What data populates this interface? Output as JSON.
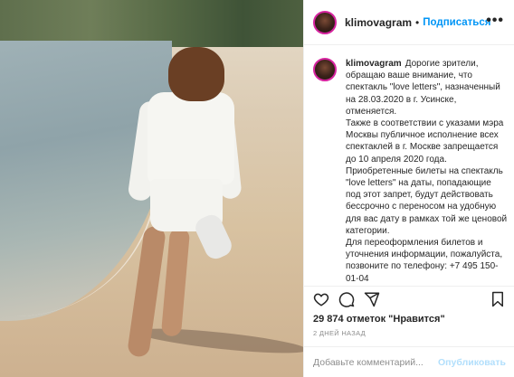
{
  "post": {
    "username": "klimovagram",
    "separator": "•",
    "follow_label": "Подписаться",
    "more_label": "•••"
  },
  "caption": {
    "username": "klimovagram",
    "lines": [
      "Дорогие зрители, обращаю ваше внимание, что спектакль \"love letters\", назначенный на 28.03.2020 в г. Усинске, отменяется.",
      "Также в соответствии с указами мэра Москвы публичное исполнение всех спектаклей в г. Москве запрещается до 10 апреля 2020 года.",
      "Приобретенные билеты на спектакль \"love letters\" на даты, попадающие под этот запрет, будут действовать бессрочно с переносом на удобную для вас дату в рамках той же ценовой категории.",
      "Для переоформления билетов и уточнения информации, пожалуйста, позвоните по телефону: +7 495 150-01-04"
    ]
  },
  "stats": {
    "likes": "29 874 отметок \"Нравится\"",
    "posted": "2 ДНЕЙ НАЗАД"
  },
  "comment_box": {
    "placeholder": "Добавьте комментарий...",
    "publish_label": "Опубликовать"
  },
  "icons": [
    "heart-icon",
    "comment-icon",
    "share-icon",
    "bookmark-icon",
    "more-icon"
  ],
  "colors": {
    "link": "#0095f6",
    "publish_disabled": "#b2dffc",
    "muted": "#8e8e8e"
  }
}
